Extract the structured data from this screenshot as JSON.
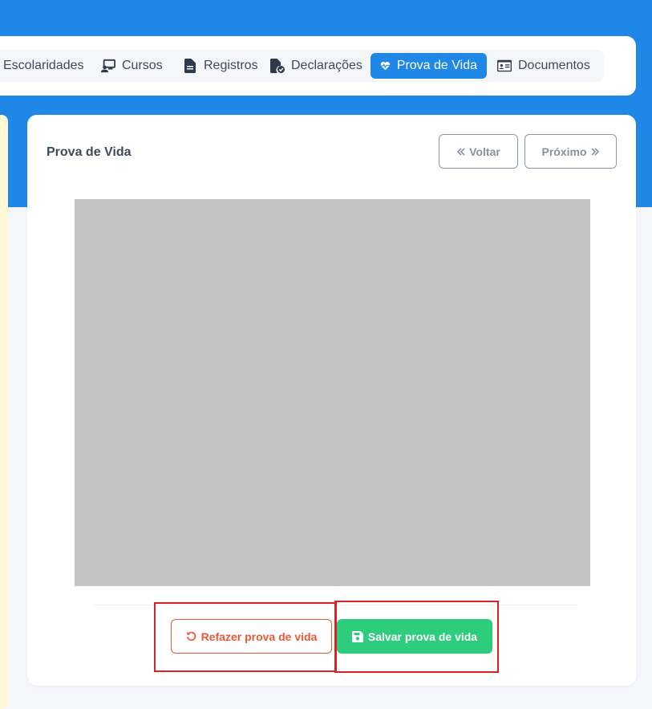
{
  "tabs": [
    {
      "label": "Escolaridades",
      "icon": "graduation-icon",
      "active": false
    },
    {
      "label": "Cursos",
      "icon": "presentation-icon",
      "active": false
    },
    {
      "label": "Registros",
      "icon": "file-text-icon",
      "active": false
    },
    {
      "label": "Declarações",
      "icon": "file-check-icon",
      "active": false
    },
    {
      "label": "Prova de Vida",
      "icon": "heart-pulse-icon",
      "active": true
    },
    {
      "label": "Documentos",
      "icon": "id-card-icon",
      "active": false
    }
  ],
  "card": {
    "title": "Prova de Vida",
    "back_label": "Voltar",
    "next_label": "Próximo"
  },
  "actions": {
    "redo_label": "Refazer prova de vida",
    "save_label": "Salvar prova de vida"
  },
  "colors": {
    "primary": "#1f87e5",
    "success": "#2ecc7d",
    "danger": "#e85a36",
    "highlight": "#e02020",
    "video_placeholder": "#c4c4c4"
  }
}
